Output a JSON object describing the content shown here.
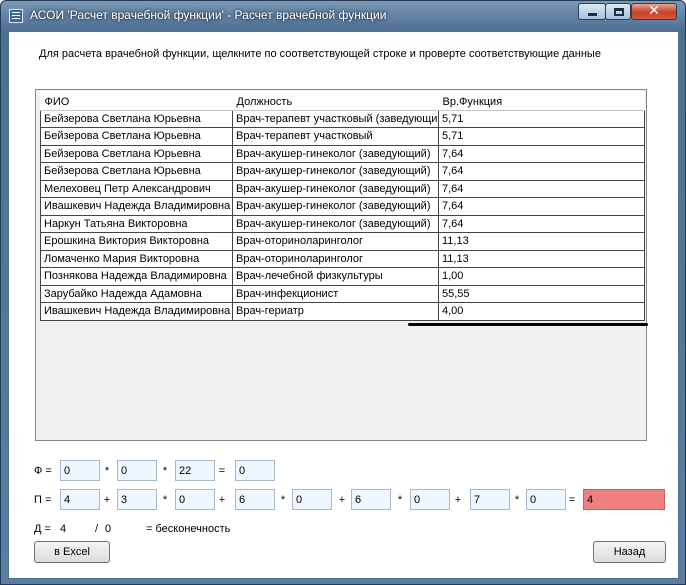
{
  "window": {
    "title": "АСОИ 'Расчет врачебной функции' - Расчет врачебной функции",
    "close_glyph": "✕"
  },
  "instruction": "Для расчета врачебной функции, щелкните по соответствующей строке и проверте соответствующие данные",
  "grid": {
    "columns": [
      "ФИО",
      "Должность",
      "Вр.Функция"
    ],
    "rows": [
      [
        "Бейзерова Светлана Юрьевна",
        "Врач-терапевт участковый (заведующи",
        "5,71"
      ],
      [
        "Бейзерова Светлана Юрьевна",
        "Врач-терапевт участковый",
        "5,71"
      ],
      [
        "Бейзерова Светлана Юрьевна",
        "Врач-акушер-гинеколог (заведующий)",
        "7,64"
      ],
      [
        "Бейзерова Светлана Юрьевна",
        "Врач-акушер-гинеколог (заведующий)",
        "7,64"
      ],
      [
        "Мелеховец Петр Александрович",
        "Врач-акушер-гинеколог (заведующий)",
        "7,64"
      ],
      [
        "Ивашкевич Надежда Владимировна",
        "Врач-акушер-гинеколог (заведующий)",
        "7,64"
      ],
      [
        "Наркун Татьяна Викторовна",
        "Врач-акушер-гинеколог (заведующий)",
        "7,64"
      ],
      [
        "Ерошкина Виктория Викторовна",
        "Врач-оториноларинголог",
        "11,13"
      ],
      [
        "Ломаченко Мария Викторовна",
        "Врач-оториноларинголог",
        "11,13"
      ],
      [
        "Познякова Надежда Владимировна",
        "Врач-лечебной физкультуры",
        "1,00"
      ],
      [
        "Зарубайко Надежда Адамовна",
        "Врач-инфекционист",
        "55,55"
      ],
      [
        "Ивашкевич Надежда Владимировна",
        "Врач-гериатр",
        "4,00"
      ]
    ]
  },
  "phi": {
    "label": "Ф =",
    "values": [
      "0",
      "0",
      "22"
    ],
    "ops": [
      "*",
      "*",
      "="
    ],
    "result": "0"
  },
  "pi": {
    "label": "П =",
    "values": [
      "4",
      "3",
      "0",
      "6",
      "0",
      "6",
      "0",
      "7",
      "0"
    ],
    "ops": [
      "+",
      "*",
      "+",
      "*",
      "+",
      "*",
      "+",
      "*",
      "="
    ],
    "result": "4",
    "result_color": "#f08080"
  },
  "d": {
    "label": "Д =",
    "numerator": "4",
    "slash": "/",
    "denominator": "0",
    "result": "= бесконечность"
  },
  "buttons": {
    "excel": "в Excel",
    "back": "Назад"
  }
}
